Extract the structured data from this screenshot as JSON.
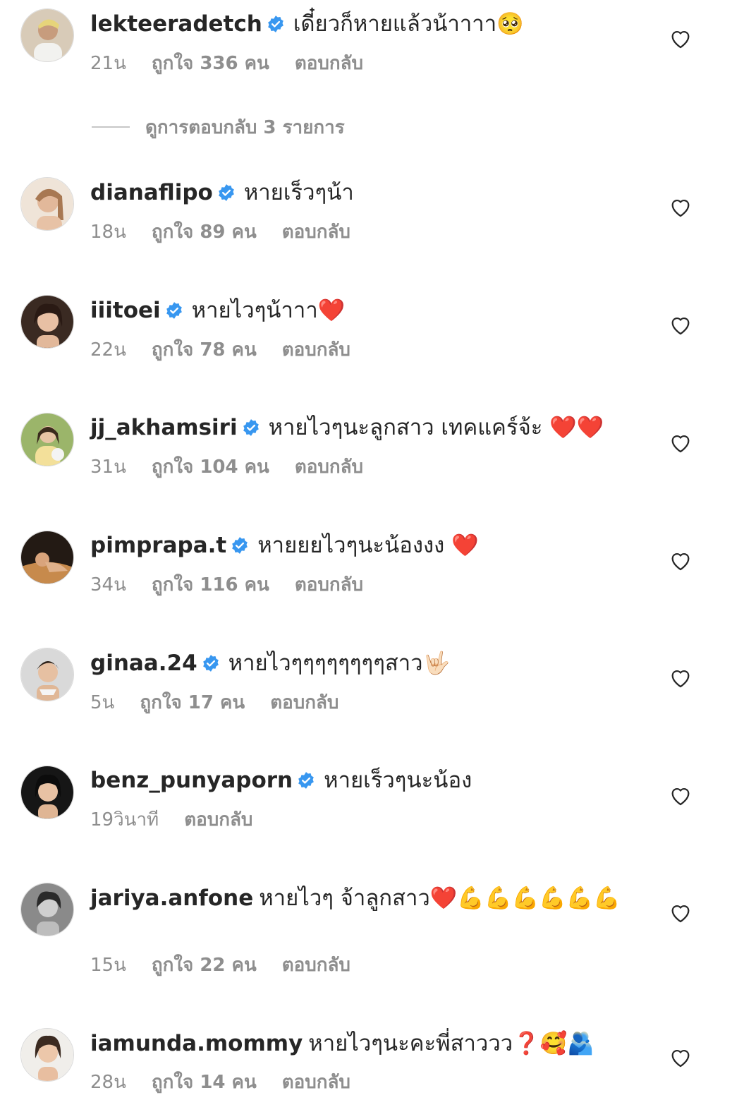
{
  "comments": [
    {
      "username": "lekteeradetch",
      "verified": true,
      "text": "เดี๋ยวก็หายแล้วน้าาาา🥺",
      "time": "21น",
      "likes": "ถูกใจ 336 คน",
      "reply": "ตอบกลับ"
    },
    {
      "username": "dianaflipo",
      "verified": true,
      "text": "หายเร็วๆน้า",
      "time": "18น",
      "likes": "ถูกใจ 89 คน",
      "reply": "ตอบกลับ"
    },
    {
      "username": "iiitoei",
      "verified": true,
      "text": "หายไวๆน้าาา❤️",
      "time": "22น",
      "likes": "ถูกใจ 78 คน",
      "reply": "ตอบกลับ"
    },
    {
      "username": "jj_akhamsiri",
      "verified": true,
      "text": "หายไวๆนะลูกสาว เทคแคร์จ้ะ ❤️❤️",
      "time": "31น",
      "likes": "ถูกใจ 104 คน",
      "reply": "ตอบกลับ"
    },
    {
      "username": "pimprapa.t",
      "verified": true,
      "text": "หายยยไวๆนะน้องงง ❤️",
      "time": "34น",
      "likes": "ถูกใจ 116 คน",
      "reply": "ตอบกลับ"
    },
    {
      "username": "ginaa.24",
      "verified": true,
      "text": "หายไวๆๆๆๆๆๆๆๆสาว🤟🏻",
      "time": "5น",
      "likes": "ถูกใจ 17 คน",
      "reply": "ตอบกลับ"
    },
    {
      "username": "benz_punyaporn",
      "verified": true,
      "text": "หายเร็วๆนะน้อง",
      "time": "19วินาที",
      "likes": "",
      "reply": "ตอบกลับ"
    },
    {
      "username": "jariya.anfone",
      "verified": false,
      "text": "หายไวๆ จ้าลูกสาว❤️💪💪💪💪💪💪",
      "time": "15น",
      "likes": "ถูกใจ 22 คน",
      "reply": "ตอบกลับ"
    },
    {
      "username": "iamunda.mommy",
      "verified": false,
      "text": "หายไวๆนะคะพี่สาววว❓🥰🫂",
      "time": "28น",
      "likes": "ถูกใจ 14 คน",
      "reply": "ตอบกลับ"
    }
  ],
  "view_replies": "ดูการตอบกลับ 3 รายการ",
  "colors": {
    "text": "#262626",
    "secondary": "#8e8e8e",
    "verified": "#3897f0"
  },
  "icons": {
    "verified": "verified-badge-icon",
    "like": "heart-outline-icon"
  }
}
